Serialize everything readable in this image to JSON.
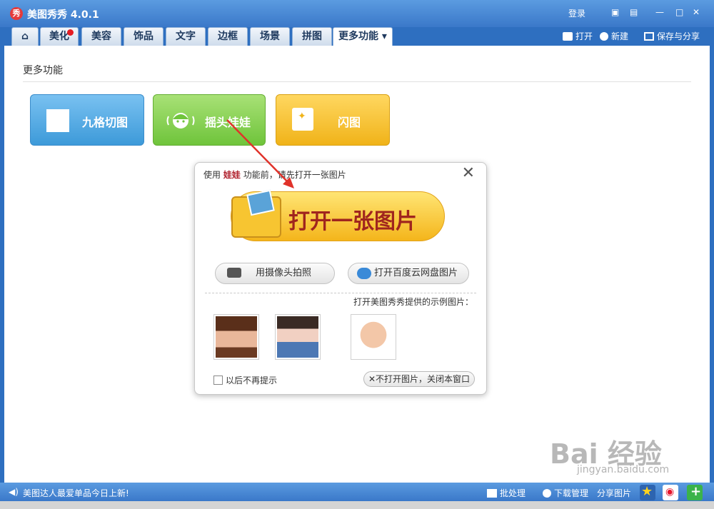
{
  "app": {
    "title": "美图秀秀 4.0.1",
    "logo_char": "秀"
  },
  "titlebar": {
    "login": "登录",
    "minimize": "—",
    "maximize": "□",
    "close": "✕"
  },
  "tabs": [
    {
      "label": "⌂",
      "name": "tab-home"
    },
    {
      "label": "美化",
      "name": "tab-beautify"
    },
    {
      "label": "美容",
      "name": "tab-beauty"
    },
    {
      "label": "饰品",
      "name": "tab-accessories"
    },
    {
      "label": "文字",
      "name": "tab-text"
    },
    {
      "label": "边框",
      "name": "tab-frame"
    },
    {
      "label": "场景",
      "name": "tab-scene"
    },
    {
      "label": "拼图",
      "name": "tab-collage"
    },
    {
      "label": "更多功能 ▾",
      "name": "tab-more"
    }
  ],
  "toolbar": {
    "open": "打开",
    "new": "新建",
    "save": "保存与分享"
  },
  "main": {
    "section_title": "更多功能",
    "features": [
      {
        "label": "九格切图"
      },
      {
        "label": "摇头娃娃"
      },
      {
        "label": "闪图"
      }
    ]
  },
  "dialog": {
    "msg_prefix": "使用",
    "msg_feature": "娃娃",
    "msg_suffix": "功能前，请先打开一张图片",
    "close": "✕",
    "open_label": "打开一张图片",
    "camera_label": "用摄像头拍照",
    "cloud_label": "打开百度云网盘图片",
    "sample_label": "打开美图秀秀提供的示例图片：",
    "no_remind": "以后不再提示",
    "dismiss": "✕不打开图片，关闭本窗口"
  },
  "statusbar": {
    "news": "美图达人最爱单品今日上新!",
    "batch": "批处理",
    "download": "下载管理",
    "share": "分享图片"
  },
  "watermark": {
    "text": "Bai 经验",
    "sub": "jingyan.baidu.com"
  }
}
